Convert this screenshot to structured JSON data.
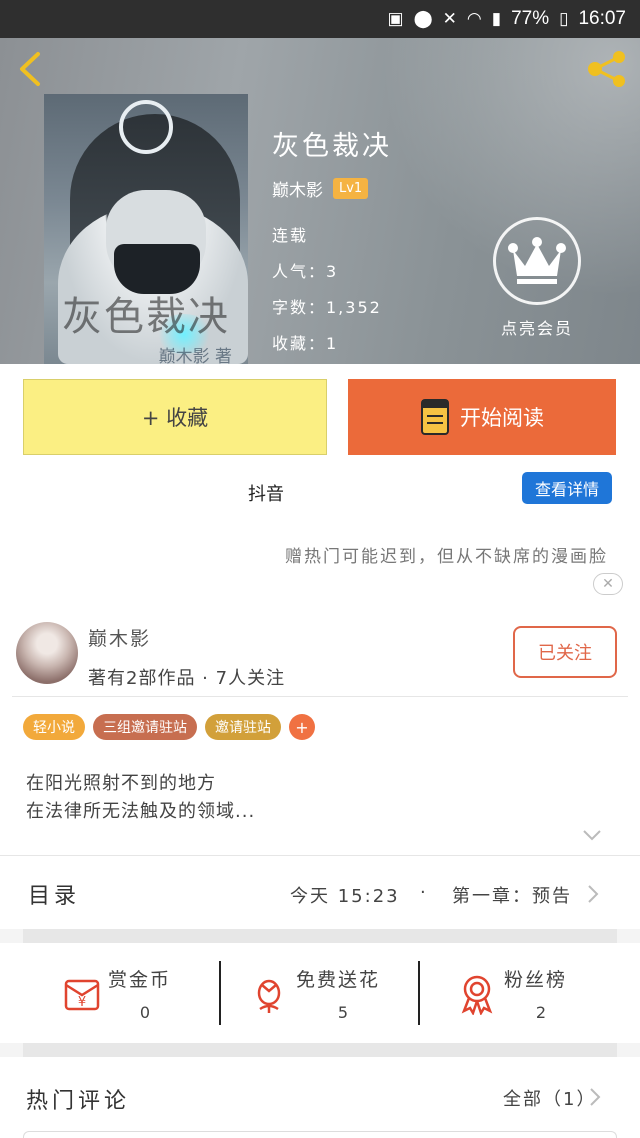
{
  "status_bar": {
    "battery": "77%",
    "time": "16:07"
  },
  "book": {
    "title": "灰色裁决",
    "author": "巅木影",
    "level": "Lv1",
    "status": "连载",
    "popularity": "人气：3",
    "words": "字数：1,352",
    "favorites": "收藏：1",
    "cover_title": "灰色裁决",
    "cover_author": "巅木影 著"
  },
  "vip": {
    "label": "点亮会员"
  },
  "actions": {
    "collect": "+ 收藏",
    "read": "开始阅读"
  },
  "tag_section": {
    "tag_name": "抖音",
    "detail_button": "查看详情",
    "promo": "赠热门可能迟到，但从不缺席的漫画脸",
    "close": "✕"
  },
  "author_card": {
    "name": "巅木影",
    "stats": "著有2部作品 · 7人关注",
    "follow": "已关注",
    "tags": [
      {
        "label": "轻小说",
        "color": "#f2a93b"
      },
      {
        "label": "三组邀请驻站",
        "color": "#c76e50"
      },
      {
        "label": "邀请驻站",
        "color": "#d2a03a"
      }
    ],
    "tag_add": "+",
    "description": [
      "在阳光照射不到的地方",
      "在法律所无法触及的领域..."
    ]
  },
  "catalog": {
    "label": "目录",
    "time": "今天 15:23",
    "dot": "·",
    "chapter": "第一章：预告"
  },
  "stats": [
    {
      "label": "赏金币",
      "value": "0",
      "icon": "red-envelope-icon"
    },
    {
      "label": "免费送花",
      "value": "5",
      "icon": "flower-icon"
    },
    {
      "label": "粉丝榜",
      "value": "2",
      "icon": "medal-icon"
    }
  ],
  "comments": {
    "title": "热门评论",
    "all": "全部（1）"
  },
  "colors": {
    "accent_orange": "#eb6a3a",
    "collect_yellow": "#fbef83",
    "blue": "#1f76d8",
    "follow_red": "#e06749",
    "icon_red": "#e0442f"
  }
}
